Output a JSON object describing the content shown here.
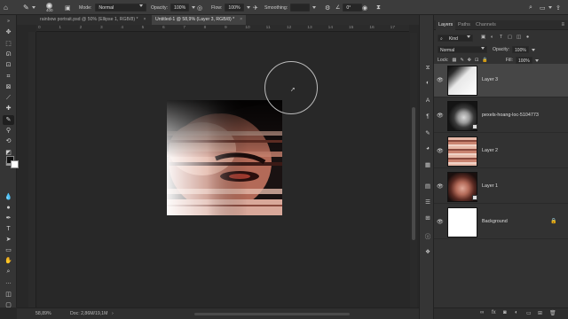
{
  "options_bar": {
    "brush_size": "400",
    "mode_label": "Mode:",
    "mode_value": "Normal",
    "opacity_label": "Opacity:",
    "opacity_value": "100%",
    "flow_label": "Flow:",
    "flow_value": "100%",
    "smoothing_label": "Smoothing:",
    "angle_value": "0°"
  },
  "doc_tabs": [
    {
      "title": "rainbow portrait.psd @ 50% (Ellipse 1, RGB/8) *",
      "active": false
    },
    {
      "title": "Untitled-1 @ 58,9% (Layer 3, RGB/8) *",
      "active": true
    }
  ],
  "ruler_top": [
    "0",
    "1",
    "2",
    "3",
    "4",
    "5",
    "6",
    "7",
    "8",
    "9",
    "10",
    "11",
    "12",
    "13",
    "14",
    "15",
    "16",
    "17"
  ],
  "status": {
    "zoom": "58,89%",
    "doc_info": "Doc: 2,86M/19,1M"
  },
  "layers_panel": {
    "tabs": [
      "Layers",
      "Paths",
      "Channels"
    ],
    "active_tab": "Layers",
    "filter_kind": "Kind",
    "blend_mode": "Normal",
    "opacity_label": "Opacity:",
    "opacity_value": "100%",
    "lock_label": "Lock:",
    "fill_label": "Fill:",
    "fill_value": "100%",
    "layers": [
      {
        "name": "Layer 3",
        "selected": true
      },
      {
        "name": "pexels-hoang-loc-5104773",
        "selected": false
      },
      {
        "name": "Layer 2",
        "selected": false
      },
      {
        "name": "Layer 1",
        "selected": false
      },
      {
        "name": "Background",
        "selected": false
      }
    ]
  },
  "colors": {
    "ui_dark": "#282828",
    "panel": "#323232",
    "foreground_color": "#111111",
    "background_color": "#ffffff"
  }
}
